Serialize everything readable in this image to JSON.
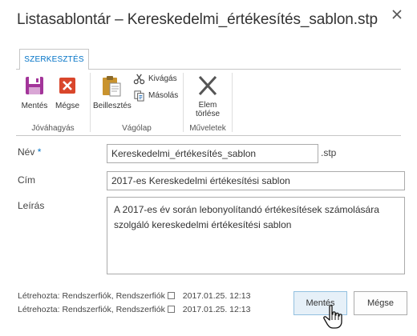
{
  "dialog": {
    "title": "Listasablontár – Kereskedelmi_értékesítés_sablon.stp",
    "close_icon": "close-x-icon"
  },
  "ribbon": {
    "tab_label": "SZERKESZTÉS",
    "groups": [
      {
        "label": "Jóváhagyás",
        "buttons": [
          {
            "label": "Mentés",
            "icon": "save-floppy-icon",
            "color": "#a3359a"
          },
          {
            "label": "Mégse",
            "icon": "cancel-x-icon",
            "color": "#d9462b"
          }
        ]
      },
      {
        "label": "Vágólap",
        "buttons": [
          {
            "label": "Beillesztés",
            "icon": "paste-clipboard-icon"
          },
          {
            "label": "Kivágás",
            "icon": "scissors-icon"
          },
          {
            "label": "Másolás",
            "icon": "copy-icon"
          }
        ]
      },
      {
        "label": "Műveletek",
        "buttons": [
          {
            "label_line1": "Elem",
            "label_line2": "törlése",
            "icon": "delete-x-icon"
          }
        ]
      }
    ]
  },
  "form": {
    "name_label": "Név",
    "required_marker": "*",
    "name_value": "Kereskedelmi_értékesítés_sablon",
    "name_suffix": ".stp",
    "title_label": "Cím",
    "title_value": "2017-es Kereskedelmi értékesítési sablon",
    "description_label": "Leírás",
    "description_value": "A 2017-es év során lebonyolítandó értékesítések számolására szolgáló kereskedelmi értékesítési sablon"
  },
  "meta": {
    "created": {
      "label": "Létrehozta: Rendszerfiók,",
      "user": "Rendszerfiók",
      "date": "2017.01.25. 12:13"
    },
    "modified": {
      "label": "Létrehozta: Rendszerfiók,",
      "user": "Rendszerfiók",
      "date": "2017.01.25. 12:13"
    }
  },
  "buttons": {
    "save_label": "Mentés",
    "cancel_label": "Mégse"
  },
  "colors": {
    "accent": "#0072c6",
    "save_icon": "#a3359a",
    "cancel_icon": "#d9462b",
    "primary_button_bg": "#e6f0f8"
  }
}
